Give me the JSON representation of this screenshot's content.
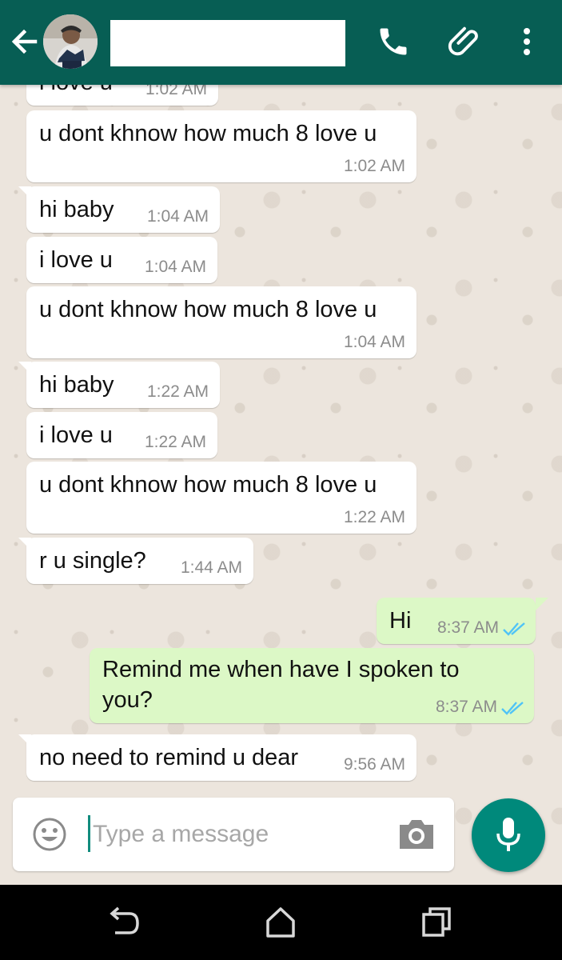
{
  "header": {
    "contact_name": "",
    "back_icon": "arrow-back-icon",
    "call_icon": "phone-icon",
    "attach_icon": "paperclip-icon",
    "menu_icon": "more-vertical-icon",
    "color": "#075e54"
  },
  "messages": [
    {
      "direction": "in",
      "text": "i love u",
      "time": "1:02 AM"
    },
    {
      "direction": "in",
      "text": "u dont khnow how much 8 love u",
      "time": "1:02 AM"
    },
    {
      "direction": "in",
      "text": "hi baby",
      "time": "1:04 AM"
    },
    {
      "direction": "in",
      "text": "i love u",
      "time": "1:04 AM"
    },
    {
      "direction": "in",
      "text": "u dont khnow how much 8 love u",
      "time": "1:04 AM"
    },
    {
      "direction": "in",
      "text": "hi baby",
      "time": "1:22 AM"
    },
    {
      "direction": "in",
      "text": "i love u",
      "time": "1:22 AM"
    },
    {
      "direction": "in",
      "text": "u dont khnow how much 8 love u",
      "time": "1:22 AM"
    },
    {
      "direction": "in",
      "text": "r u single?",
      "time": "1:44 AM"
    },
    {
      "direction": "out",
      "text": "Hi",
      "time": "8:37 AM",
      "status": "read"
    },
    {
      "direction": "out",
      "text_lines": [
        "Remind me when have I spoken to",
        "you?"
      ],
      "time": "8:37 AM",
      "status": "read"
    },
    {
      "direction": "in",
      "text": "no need to remind u dear",
      "time": "9:56 AM"
    }
  ],
  "composer": {
    "placeholder": "Type a message",
    "value": "",
    "emoji_icon": "emoji-icon",
    "camera_icon": "camera-icon",
    "mic_icon": "microphone-icon",
    "accent": "#00897b"
  },
  "navbar": {
    "back_icon": "nav-back-icon",
    "home_icon": "nav-home-icon",
    "recents_icon": "nav-recents-icon"
  },
  "colors": {
    "incoming_bubble": "#ffffff",
    "outgoing_bubble": "#dcf8c6",
    "read_ticks": "#4fc3f7"
  }
}
